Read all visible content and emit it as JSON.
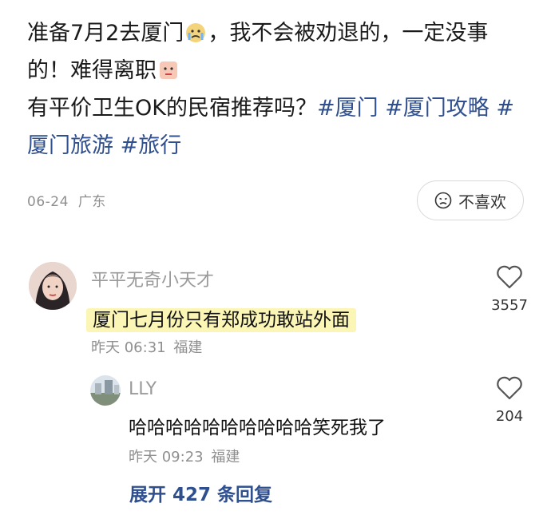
{
  "post": {
    "text_1": "准备7月2去厦门",
    "text_2": "，我不会被劝退的，一定没事的！难得离职",
    "text_3": "有平价卫生OK的民宿推荐吗？",
    "tags": [
      "#厦门",
      "#厦门攻略",
      "#厦门旅游",
      "#旅行"
    ],
    "date": "06-24",
    "location": "广东",
    "dislike_label": "不喜欢",
    "dislike_icon": "sad-face-icon"
  },
  "comments": [
    {
      "username": "平平无奇小天才",
      "text": "厦门七月份只有郑成功敢站外面",
      "time": "昨天 06:31",
      "location": "福建",
      "likes": "3557"
    }
  ],
  "reply": {
    "username": "LLY",
    "text": "哈哈哈哈哈哈哈哈哈哈笑死我了",
    "time": "昨天 09:23",
    "location": "福建",
    "likes": "204"
  },
  "expand_label": "展开 427 条回复",
  "colors": {
    "tag": "#2f4f8f",
    "highlight": "#fbf6b6",
    "meta": "#8f8f8f"
  }
}
